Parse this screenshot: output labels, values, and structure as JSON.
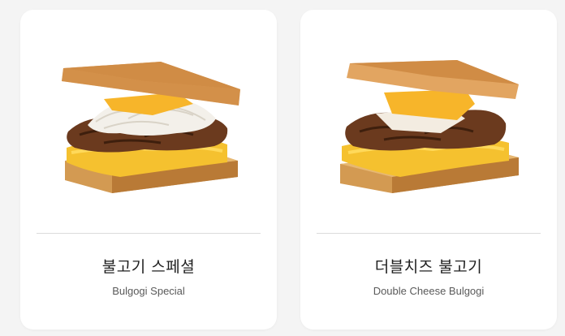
{
  "menu": {
    "items": [
      {
        "title_ko": "불고기 스페셜",
        "title_en": "Bulgogi Special",
        "image_icon": "bulgogi-special-sandwich-image"
      },
      {
        "title_ko": "더블치즈 불고기",
        "title_en": "Double Cheese Bulgogi",
        "image_icon": "double-cheese-bulgogi-sandwich-image"
      }
    ]
  }
}
